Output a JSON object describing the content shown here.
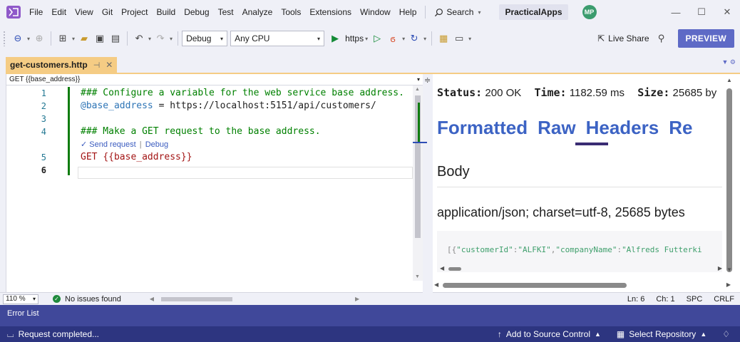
{
  "menubar": {
    "items": [
      "File",
      "Edit",
      "View",
      "Git",
      "Project",
      "Build",
      "Debug",
      "Test",
      "Analyze",
      "Tools",
      "Extensions",
      "Window",
      "Help"
    ],
    "search_label": "Search",
    "solution_name": "PracticalApps",
    "user_initials": "MP"
  },
  "toolbar": {
    "config": "Debug",
    "platform": "Any CPU",
    "run_profile": "https",
    "live_share": "Live Share",
    "preview": "PREVIEW"
  },
  "document": {
    "tab_title": "get-customers.http",
    "nav_scope": "GET {{base_address}}"
  },
  "editor": {
    "line_numbers": [
      "1",
      "2",
      "3",
      "4",
      "5",
      "6"
    ],
    "line1_comment": "### Configure a variable for the web service base address.",
    "line2_var": "@base_address",
    "line2_rest": " = https://localhost:5151/api/customers/",
    "line4_comment": "### Make a GET request to the base address.",
    "codelens_send": "Send request",
    "codelens_sep": "|",
    "codelens_debug": "Debug",
    "line5_method": "GET ",
    "line5_var": "{{base_address}}",
    "zoom": "110 %",
    "issues": "No issues found"
  },
  "response": {
    "status_label": "Status:",
    "status_value": "200 OK",
    "time_label": "Time:",
    "time_value": "1182.59 ms",
    "size_label": "Size:",
    "size_value": "25685 by",
    "tabs": [
      "Formatted",
      "Raw",
      "Headers",
      "Re"
    ],
    "active_tab": "Raw",
    "body_heading": "Body",
    "content_type": "application/json; charset=utf-8, 25685 bytes",
    "json_prefix": "[{",
    "json_k1": "\"customerId\"",
    "json_colon": ":",
    "json_v1": "\"ALFKI\"",
    "json_comma": ",",
    "json_k2": "\"companyName\"",
    "json_v2": "\"Alfreds Futterki",
    "cursor_line": "Ln: 6",
    "cursor_col": "Ch: 1",
    "whitespace": "SPC",
    "line_ending": "CRLF"
  },
  "error_list": {
    "title": "Error List"
  },
  "statusbar": {
    "message": "Request completed...",
    "source_control": "Add to Source Control",
    "repository": "Select Repository"
  },
  "colors": {
    "accent": "#5e6ac6",
    "status_bar": "#2d3580",
    "error_list_bar": "#40489a",
    "active_tab": "#f5cc84",
    "ok_green": "#128a55",
    "resp_tab_blue": "#3c63c4"
  }
}
